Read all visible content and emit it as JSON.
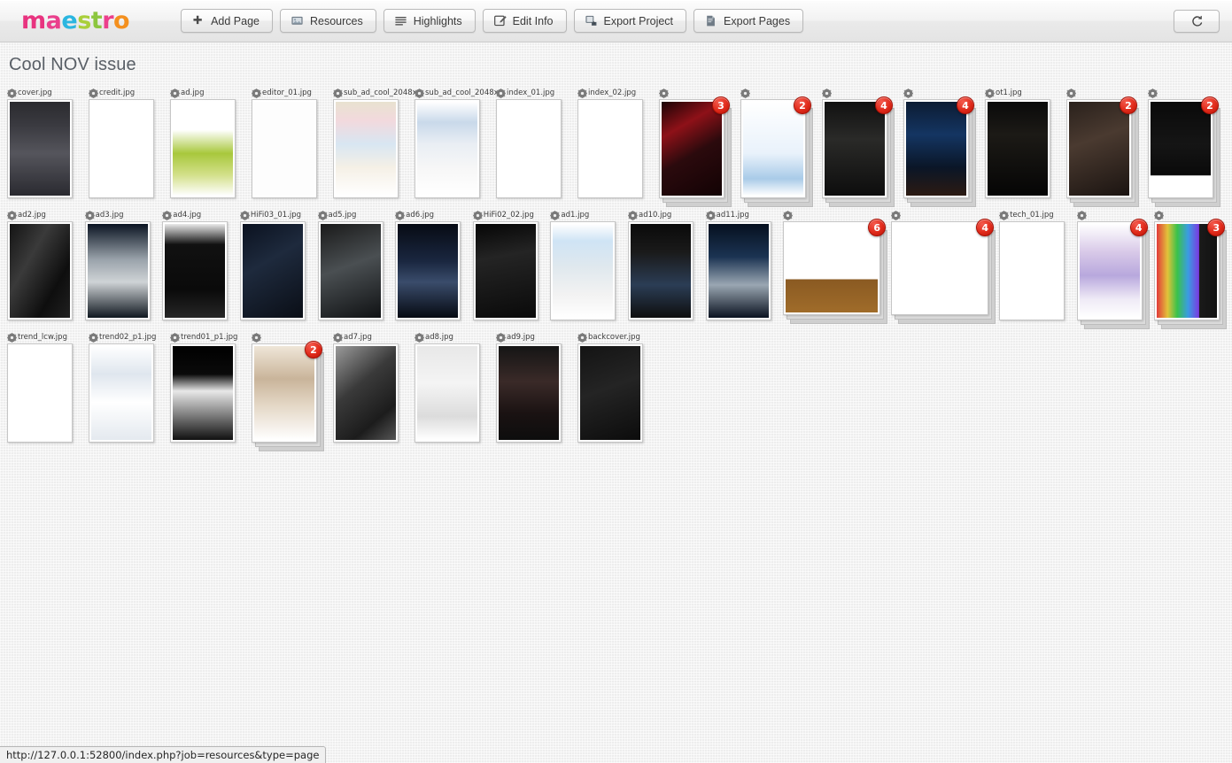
{
  "app": {
    "logo_text": "maestro",
    "logo_colors": [
      "#e8337f",
      "#ea3f8c",
      "#2bb6e0",
      "#a9cf3a",
      "#8cc63f",
      "#ec3f8c",
      "#f4901e"
    ]
  },
  "toolbar": {
    "buttons": [
      {
        "label": "Add Page",
        "icon": "plus-icon"
      },
      {
        "label": "Resources",
        "icon": "image-icon"
      },
      {
        "label": "Highlights",
        "icon": "lines-icon"
      },
      {
        "label": "Edit Info",
        "icon": "edit-icon"
      },
      {
        "label": "Export Project",
        "icon": "export-project-icon"
      },
      {
        "label": "Export Pages",
        "icon": "export-pages-icon"
      }
    ],
    "refresh": {
      "label": "↻",
      "icon": "refresh-icon"
    }
  },
  "page": {
    "title": "Cool NOV issue"
  },
  "statusbar": {
    "url": "http://127.0.0.1:52800/index.php?job=resources&type=page"
  },
  "grid": {
    "rows": [
      [
        {
          "filename": "cover.jpg",
          "badge": null,
          "wide": false,
          "art": "cover"
        },
        {
          "filename": "credit.jpg",
          "badge": null,
          "wide": false,
          "art": "credit"
        },
        {
          "filename": "ad.jpg",
          "badge": null,
          "wide": false,
          "art": "ad-green"
        },
        {
          "filename": "editor_01.jpg",
          "badge": null,
          "wide": false,
          "art": "editor"
        },
        {
          "filename": "sub_ad_cool_2048x",
          "badge": null,
          "wide": false,
          "art": "subad1"
        },
        {
          "filename": "sub_ad_cool_2048x",
          "badge": null,
          "wide": false,
          "art": "subad2"
        },
        {
          "filename": "index_01.jpg",
          "badge": null,
          "wide": false,
          "art": "index1"
        },
        {
          "filename": "index_02.jpg",
          "badge": null,
          "wide": false,
          "art": "index2"
        },
        {
          "filename": "",
          "badge": "3",
          "wide": false,
          "art": "mini-car"
        },
        {
          "filename": "",
          "badge": "2",
          "wide": false,
          "art": "bugatti"
        },
        {
          "filename": "",
          "badge": "4",
          "wide": false,
          "art": "rolls"
        },
        {
          "filename": "",
          "badge": "4",
          "wide": false,
          "art": "mazda"
        },
        {
          "filename": "ot1.jpg",
          "badge": null,
          "wide": false,
          "art": "ot1"
        },
        {
          "filename": "",
          "badge": "2",
          "wide": false,
          "art": "watch"
        },
        {
          "filename": "",
          "badge": "2",
          "wide": false,
          "art": "iwc"
        }
      ],
      [
        {
          "filename": "ad2.jpg",
          "badge": null,
          "wide": false,
          "art": "ad2"
        },
        {
          "filename": "ad3.jpg",
          "badge": null,
          "wide": false,
          "art": "ad3"
        },
        {
          "filename": "ad4.jpg",
          "badge": null,
          "wide": false,
          "art": "ad4"
        },
        {
          "filename": "HiFi03_01.jpg",
          "badge": null,
          "wide": false,
          "art": "hifi3"
        },
        {
          "filename": "ad5.jpg",
          "badge": null,
          "wide": false,
          "art": "ad5"
        },
        {
          "filename": "ad6.jpg",
          "badge": null,
          "wide": false,
          "art": "ad6"
        },
        {
          "filename": "HiFi02_02.jpg",
          "badge": null,
          "wide": false,
          "art": "hifi2"
        },
        {
          "filename": "ad1.jpg",
          "badge": null,
          "wide": false,
          "art": "ad1"
        },
        {
          "filename": "ad10.jpg",
          "badge": null,
          "wide": false,
          "art": "ad10"
        },
        {
          "filename": "ad11.jpg",
          "badge": null,
          "wide": false,
          "art": "ad11"
        },
        {
          "filename": "",
          "badge": "6",
          "wide": true,
          "art": "tommy"
        },
        {
          "filename": "",
          "badge": "4",
          "wide": true,
          "art": "pattern"
        },
        {
          "filename": "tech_01.jpg",
          "badge": null,
          "wide": false,
          "art": "tech"
        },
        {
          "filename": "",
          "badge": "4",
          "wide": false,
          "art": "laptop"
        },
        {
          "filename": "",
          "badge": "3",
          "wide": false,
          "art": "colorbars"
        }
      ],
      [
        {
          "filename": "trend_lcw.jpg",
          "badge": null,
          "wide": false,
          "art": "chair"
        },
        {
          "filename": "trend02_p1.jpg",
          "badge": null,
          "wide": false,
          "art": "trend02"
        },
        {
          "filename": "trend01_p1.jpg",
          "badge": null,
          "wide": false,
          "art": "trend01"
        },
        {
          "filename": "",
          "badge": "2",
          "wide": false,
          "art": "dress"
        },
        {
          "filename": "ad7.jpg",
          "badge": null,
          "wide": false,
          "art": "ad7"
        },
        {
          "filename": "ad8.jpg",
          "badge": null,
          "wide": false,
          "art": "ad8"
        },
        {
          "filename": "ad9.jpg",
          "badge": null,
          "wide": false,
          "art": "ad9"
        },
        {
          "filename": "backcover.jpg",
          "badge": null,
          "wide": false,
          "art": "backcover"
        }
      ]
    ]
  }
}
